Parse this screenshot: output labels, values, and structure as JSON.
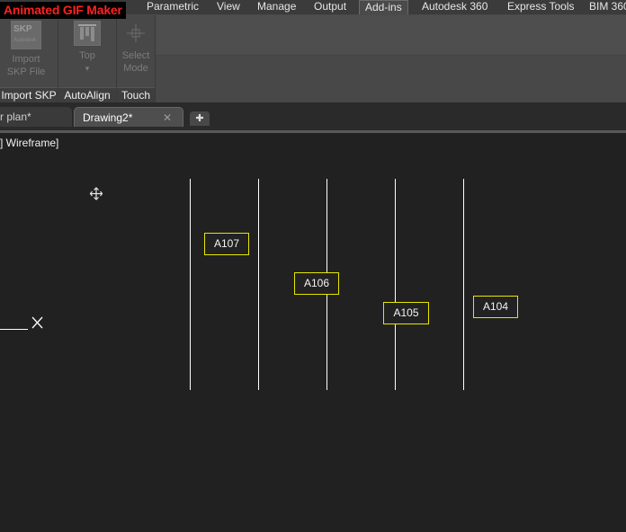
{
  "overlay_badge": "Animated GIF Maker",
  "ribbon_tabs": [
    {
      "label": "Parametric",
      "active": false
    },
    {
      "label": "View",
      "active": false
    },
    {
      "label": "Manage",
      "active": false
    },
    {
      "label": "Output",
      "active": false
    },
    {
      "label": "Add-ins",
      "active": true
    },
    {
      "label": "Autodesk 360",
      "active": false
    },
    {
      "label": "Express Tools",
      "active": false
    },
    {
      "label": "BIM 360",
      "active": false
    }
  ],
  "ribbon_panels": [
    {
      "title": "Import SKP",
      "button_line1": "Import",
      "button_line2": "SKP File",
      "icon_text": "SKP",
      "icon_subtext": "Autodesk"
    },
    {
      "title": "AutoAlign",
      "button_line1": "Top",
      "button_line2": "▾"
    },
    {
      "title": "Touch",
      "button_line1": "Select",
      "button_line2": "Mode"
    }
  ],
  "document_tabs": [
    {
      "label": "r plan*",
      "active": false
    },
    {
      "label": "Drawing2*",
      "active": true
    }
  ],
  "viewport_label": "] Wireframe]",
  "room_tags": [
    "A107",
    "A106",
    "A105",
    "A104"
  ],
  "colors": {
    "accent_yellow": "#e6e600",
    "background": "#212121",
    "gif_badge_red": "#ff2020"
  }
}
